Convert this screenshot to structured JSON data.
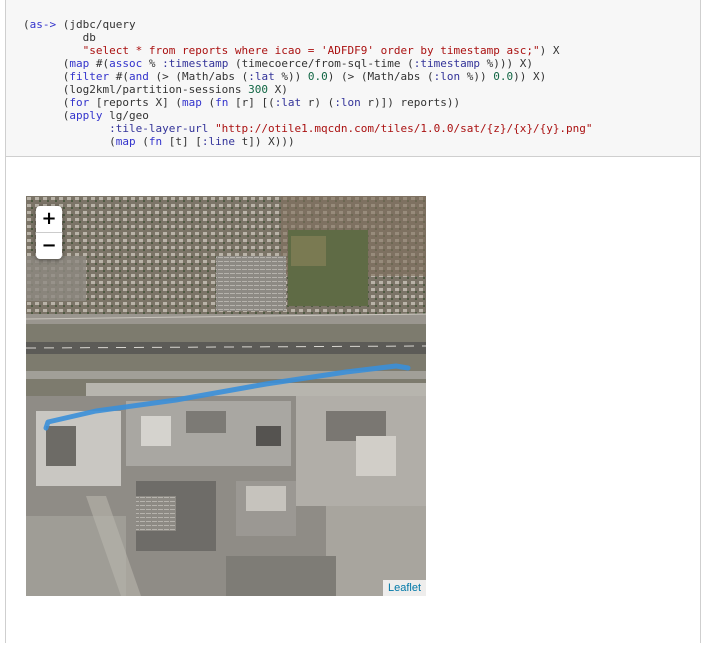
{
  "notebook_cell": {
    "code_lines": [
      [
        {
          "t": "(",
          "c": "p"
        },
        {
          "t": "as->",
          "c": "k"
        },
        {
          "t": " (jdbc/query",
          "c": "p"
        }
      ],
      [
        {
          "t": "         db",
          "c": "p"
        }
      ],
      [
        {
          "t": "         ",
          "c": "p"
        },
        {
          "t": "\"select * from reports where icao = 'ADFDF9' order by timestamp asc;\"",
          "c": "s"
        },
        {
          "t": ") X",
          "c": "p"
        }
      ],
      [
        {
          "t": "      (",
          "c": "p"
        },
        {
          "t": "map",
          "c": "k"
        },
        {
          "t": " #(",
          "c": "p"
        },
        {
          "t": "assoc",
          "c": "k"
        },
        {
          "t": " % ",
          "c": "p"
        },
        {
          "t": ":timestamp",
          "c": "a"
        },
        {
          "t": " (timecoerce/from-sql-time (",
          "c": "p"
        },
        {
          "t": ":timestamp",
          "c": "a"
        },
        {
          "t": " %))) X)",
          "c": "p"
        }
      ],
      [
        {
          "t": "      (",
          "c": "p"
        },
        {
          "t": "filter",
          "c": "k"
        },
        {
          "t": " #(",
          "c": "p"
        },
        {
          "t": "and",
          "c": "k"
        },
        {
          "t": " (> (Math/abs (",
          "c": "p"
        },
        {
          "t": ":lat",
          "c": "a"
        },
        {
          "t": " %)) ",
          "c": "p"
        },
        {
          "t": "0.0",
          "c": "n"
        },
        {
          "t": ") (> (Math/abs (",
          "c": "p"
        },
        {
          "t": ":lon",
          "c": "a"
        },
        {
          "t": " %)) ",
          "c": "p"
        },
        {
          "t": "0.0",
          "c": "n"
        },
        {
          "t": ")) X)",
          "c": "p"
        }
      ],
      [
        {
          "t": "      (log2kml/partition-sessions ",
          "c": "p"
        },
        {
          "t": "300",
          "c": "n"
        },
        {
          "t": " X)",
          "c": "p"
        }
      ],
      [
        {
          "t": "      (",
          "c": "p"
        },
        {
          "t": "for",
          "c": "k"
        },
        {
          "t": " [reports X] (",
          "c": "p"
        },
        {
          "t": "map",
          "c": "k"
        },
        {
          "t": " (",
          "c": "p"
        },
        {
          "t": "fn",
          "c": "k"
        },
        {
          "t": " [r] [(",
          "c": "p"
        },
        {
          "t": ":lat",
          "c": "a"
        },
        {
          "t": " r) (",
          "c": "p"
        },
        {
          "t": ":lon",
          "c": "a"
        },
        {
          "t": " r)]) reports))",
          "c": "p"
        }
      ],
      [
        {
          "t": "      (",
          "c": "p"
        },
        {
          "t": "apply",
          "c": "k"
        },
        {
          "t": " lg/geo",
          "c": "p"
        }
      ],
      [
        {
          "t": "             ",
          "c": "p"
        },
        {
          "t": ":tile-layer-url",
          "c": "a"
        },
        {
          "t": " ",
          "c": "p"
        },
        {
          "t": "\"http://otile1.mqcdn.com/tiles/1.0.0/sat/{z}/{x}/{y}.png\"",
          "c": "s"
        }
      ],
      [
        {
          "t": "             (",
          "c": "p"
        },
        {
          "t": "map",
          "c": "k"
        },
        {
          "t": " (",
          "c": "p"
        },
        {
          "t": "fn",
          "c": "k"
        },
        {
          "t": " [t] [",
          "c": "p"
        },
        {
          "t": ":line",
          "c": "a"
        },
        {
          "t": " t]) X)))",
          "c": "p"
        }
      ]
    ]
  },
  "map": {
    "zoom_in_label": "+",
    "zoom_out_label": "−",
    "attribution": "Leaflet",
    "track_color": "#3a8fd9"
  }
}
